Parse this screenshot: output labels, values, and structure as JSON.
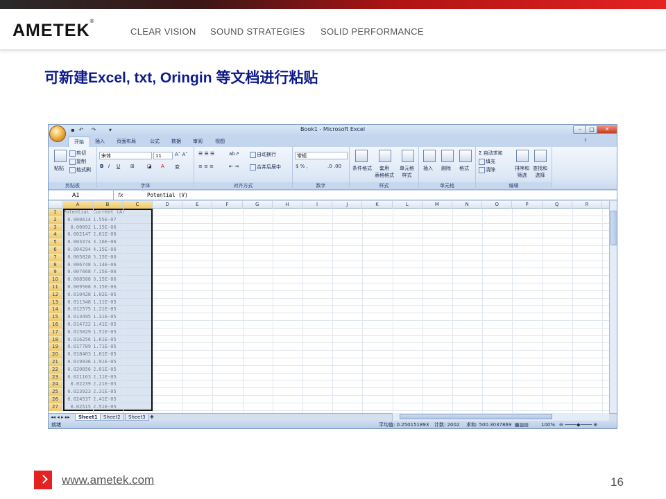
{
  "slide": {
    "logo": "AMETEK",
    "logo_mark": "®",
    "taglines": [
      "CLEAR VISION",
      "SOUND STRATEGIES",
      "SOLID PERFORMANCE"
    ],
    "title": "可新建Excel, txt, Oringin 等文档进行粘贴",
    "footer_url": "www.ametek.com",
    "page_number": "16",
    "colors": {
      "accent_red": "#e52222",
      "title_blue": "#0d1a8c"
    }
  },
  "excel": {
    "window_title": "Book1 - Microsoft Excel",
    "ribbon_tabs": [
      "开始",
      "插入",
      "页面布局",
      "公式",
      "数据",
      "审阅",
      "视图"
    ],
    "groups": {
      "clipboard": {
        "label": "剪贴板",
        "paste": "粘贴",
        "cut": "剪切",
        "copy": "复制",
        "format_painter": "格式刷"
      },
      "font": {
        "label": "字体",
        "font_name": "宋体",
        "font_size": "11"
      },
      "alignment": {
        "label": "对齐方式",
        "wrap": "自动换行",
        "merge": "合并后居中"
      },
      "number": {
        "label": "数字",
        "format": "常规"
      },
      "styles": {
        "label": "样式",
        "conditional": "条件格式",
        "table": "套用\n表格格式",
        "cell_styles": "单元格\n样式"
      },
      "cells": {
        "label": "单元格",
        "insert": "插入",
        "delete": "删除",
        "format": "格式"
      },
      "editing": {
        "label": "编辑",
        "autosum": "自动求和",
        "fill": "填充",
        "clear": "清除",
        "sort": "排序和\n筛选",
        "find": "查找和\n选择"
      }
    },
    "name_box": "A1",
    "fx": "fx",
    "formula": "Potential (V)",
    "columns": [
      "A",
      "B",
      "C",
      "D",
      "E",
      "F",
      "G",
      "H",
      "I",
      "J",
      "K",
      "L",
      "M",
      "N",
      "O",
      "P",
      "Q",
      "R"
    ],
    "rows": [
      {
        "n": "1",
        "a": "Potential",
        "b": "Current (A)"
      },
      {
        "n": "2",
        "a": "0.000614",
        "b": "1.55E-07"
      },
      {
        "n": "3",
        "a": "0.00092",
        "b": "1.15E-06"
      },
      {
        "n": "4",
        "a": "0.002147",
        "b": "2.01E-06"
      },
      {
        "n": "5",
        "a": "0.003374",
        "b": "3.16E-06"
      },
      {
        "n": "6",
        "a": "0.004294",
        "b": "4.15E-06"
      },
      {
        "n": "7",
        "a": "0.005828",
        "b": "5.15E-06"
      },
      {
        "n": "8",
        "a": "0.006748",
        "b": "6.14E-06"
      },
      {
        "n": "9",
        "a": "0.007668",
        "b": "7.15E-06"
      },
      {
        "n": "10",
        "a": "0.008588",
        "b": "8.15E-06"
      },
      {
        "n": "11",
        "a": "0.009508",
        "b": "9.15E-06"
      },
      {
        "n": "12",
        "a": "0.010428",
        "b": "1.02E-05"
      },
      {
        "n": "13",
        "a": "0.011348",
        "b": "1.11E-05"
      },
      {
        "n": "14",
        "a": "0.012575",
        "b": "1.21E-05"
      },
      {
        "n": "15",
        "a": "0.013495",
        "b": "1.31E-05"
      },
      {
        "n": "16",
        "a": "0.014722",
        "b": "1.41E-05"
      },
      {
        "n": "17",
        "a": "0.015029",
        "b": "1.51E-05"
      },
      {
        "n": "18",
        "a": "0.016256",
        "b": "1.61E-05"
      },
      {
        "n": "19",
        "a": "0.017789",
        "b": "1.71E-05"
      },
      {
        "n": "20",
        "a": "0.018403",
        "b": "1.81E-05"
      },
      {
        "n": "21",
        "a": "0.019936",
        "b": "1.91E-05"
      },
      {
        "n": "22",
        "a": "0.020856",
        "b": "2.01E-05"
      },
      {
        "n": "23",
        "a": "0.021163",
        "b": "2.11E-05"
      },
      {
        "n": "24",
        "a": "0.02239",
        "b": "2.21E-05"
      },
      {
        "n": "25",
        "a": "0.023923",
        "b": "2.31E-05"
      },
      {
        "n": "26",
        "a": "0.024537",
        "b": "2.41E-05"
      },
      {
        "n": "27",
        "a": "0.02515",
        "b": "2.51E-05"
      }
    ],
    "sheets": [
      "Sheet1",
      "Sheet2",
      "Sheet3"
    ],
    "status": {
      "ready": "就绪",
      "average": "平均值: 0.250151893",
      "count": "计数: 2002",
      "sum": "求和: 500.3037869",
      "zoom": "100%"
    }
  }
}
